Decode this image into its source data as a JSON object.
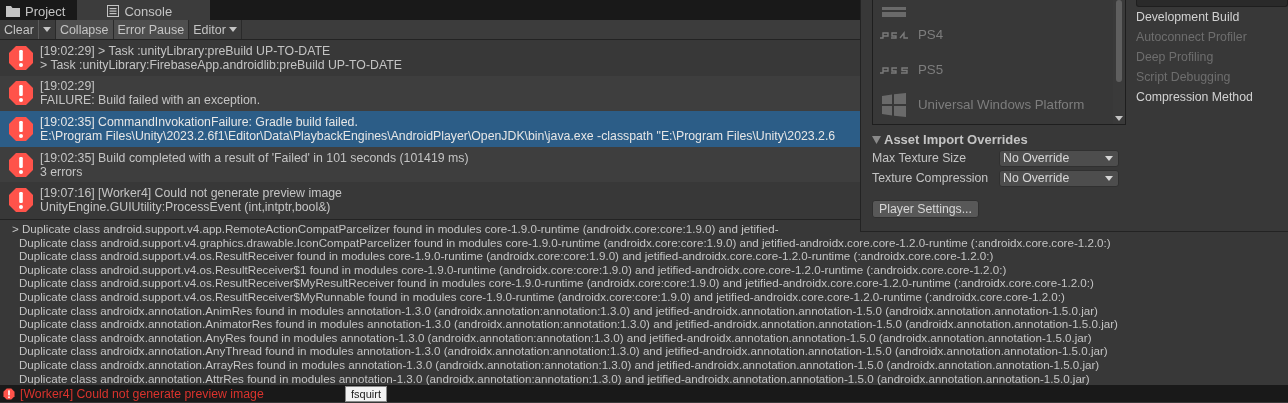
{
  "tabs": [
    {
      "label": "Project",
      "selected": false
    },
    {
      "label": "Console",
      "selected": true
    }
  ],
  "toolbar": [
    {
      "label": "Clear",
      "kind": "split"
    },
    {
      "label": "Collapse",
      "kind": "toggle",
      "on": true
    },
    {
      "label": "Error Pause",
      "kind": "toggle",
      "on": true
    },
    {
      "label": "Editor",
      "kind": "dropdown"
    }
  ],
  "log_entries": [
    {
      "lines": [
        "[19:02:29] > Task :unityLibrary:preBuild UP-TO-DATE",
        "> Task :unityLibrary:FirebaseApp.androidlib:preBuild UP-TO-DATE"
      ],
      "selected": false
    },
    {
      "lines": [
        "[19:02:29]",
        "FAILURE: Build failed with an exception."
      ],
      "selected": false
    },
    {
      "lines": [
        "[19:02:35] CommandInvokationFailure: Gradle build failed.",
        "E:\\Program Files\\Unity\\2023.2.6f1\\Editor\\Data\\PlaybackEngines\\AndroidPlayer\\OpenJDK\\bin\\java.exe -classpath \"E:\\Program Files\\Unity\\2023.2.6"
      ],
      "selected": true
    },
    {
      "lines": [
        "[19:02:35] Build completed with a result of 'Failed' in 101 seconds (101419 ms)",
        "3 errors"
      ],
      "selected": false
    },
    {
      "lines": [
        "[19:07:16] [Worker4] Could not generate preview image",
        "UnityEngine.GUIUtility:ProcessEvent (int,intptr,bool&)"
      ],
      "selected": false
    }
  ],
  "details": [
    "> Duplicate class android.support.v4.app.RemoteActionCompatParcelizer found in modules core-1.9.0-runtime (androidx.core:core:1.9.0) and jetified-",
    "Duplicate class android.support.v4.graphics.drawable.IconCompatParcelizer found in modules core-1.9.0-runtime (androidx.core:core:1.9.0) and jetified-androidx.core.core-1.2.0-runtime (:androidx.core.core-1.2.0:)",
    "Duplicate class android.support.v4.os.ResultReceiver found in modules core-1.9.0-runtime (androidx.core:core:1.9.0) and jetified-androidx.core.core-1.2.0-runtime (:androidx.core.core-1.2.0:)",
    "Duplicate class android.support.v4.os.ResultReceiver$1 found in modules core-1.9.0-runtime (androidx.core:core:1.9.0) and jetified-androidx.core.core-1.2.0-runtime (:androidx.core.core-1.2.0:)",
    "Duplicate class android.support.v4.os.ResultReceiver$MyResultReceiver found in modules core-1.9.0-runtime (androidx.core:core:1.9.0) and jetified-androidx.core.core-1.2.0-runtime (:androidx.core.core-1.2.0:)",
    "Duplicate class android.support.v4.os.ResultReceiver$MyRunnable found in modules core-1.9.0-runtime (androidx.core:core:1.9.0) and jetified-androidx.core.core-1.2.0-runtime (:androidx.core.core-1.2.0:)",
    "Duplicate class androidx.annotation.AnimRes found in modules annotation-1.3.0 (androidx.annotation:annotation:1.3.0) and jetified-androidx.annotation.annotation-1.5.0 (androidx.annotation.annotation-1.5.0.jar)",
    "Duplicate class androidx.annotation.AnimatorRes found in modules annotation-1.3.0 (androidx.annotation:annotation:1.3.0) and jetified-androidx.annotation.annotation-1.5.0 (androidx.annotation.annotation-1.5.0.jar)",
    "Duplicate class androidx.annotation.AnyRes found in modules annotation-1.3.0 (androidx.annotation:annotation:1.3.0) and jetified-androidx.annotation.annotation-1.5.0 (androidx.annotation.annotation-1.5.0.jar)",
    "Duplicate class androidx.annotation.AnyThread found in modules annotation-1.3.0 (androidx.annotation:annotation:1.3.0) and jetified-androidx.annotation.annotation-1.5.0 (androidx.annotation.annotation-1.5.0.jar)",
    "Duplicate class androidx.annotation.ArrayRes found in modules annotation-1.3.0 (androidx.annotation:annotation:1.3.0) and jetified-androidx.annotation.annotation-1.5.0 (androidx.annotation.annotation-1.5.0.jar)",
    "Duplicate class androidx.annotation.AttrRes found in modules annotation-1.3.0 (androidx.annotation:annotation:1.3.0) and jetified-androidx.annotation.annotation-1.5.0 (androidx.annotation.annotation-1.5.0.jar)"
  ],
  "build_settings": {
    "platforms": [
      {
        "label": "PS4"
      },
      {
        "label": "PS5"
      },
      {
        "label": "Universal Windows Platform"
      }
    ],
    "options": [
      {
        "label": "Development Build",
        "disabled": false
      },
      {
        "label": "Autoconnect Profiler",
        "disabled": true
      },
      {
        "label": "Deep Profiling",
        "disabled": true
      },
      {
        "label": "Script Debugging",
        "disabled": true
      },
      {
        "label": "Compression Method",
        "disabled": false
      }
    ],
    "overrides": {
      "title": "Asset Import Overrides",
      "expanded": true,
      "fields": [
        {
          "label": "Max Texture Size",
          "value": "No Override"
        },
        {
          "label": "Texture Compression",
          "value": "No Override"
        }
      ]
    },
    "button": "Player Settings..."
  },
  "status_bar": {
    "message": "[Worker4] Could not generate preview image"
  },
  "tooltip": "fsquirt"
}
